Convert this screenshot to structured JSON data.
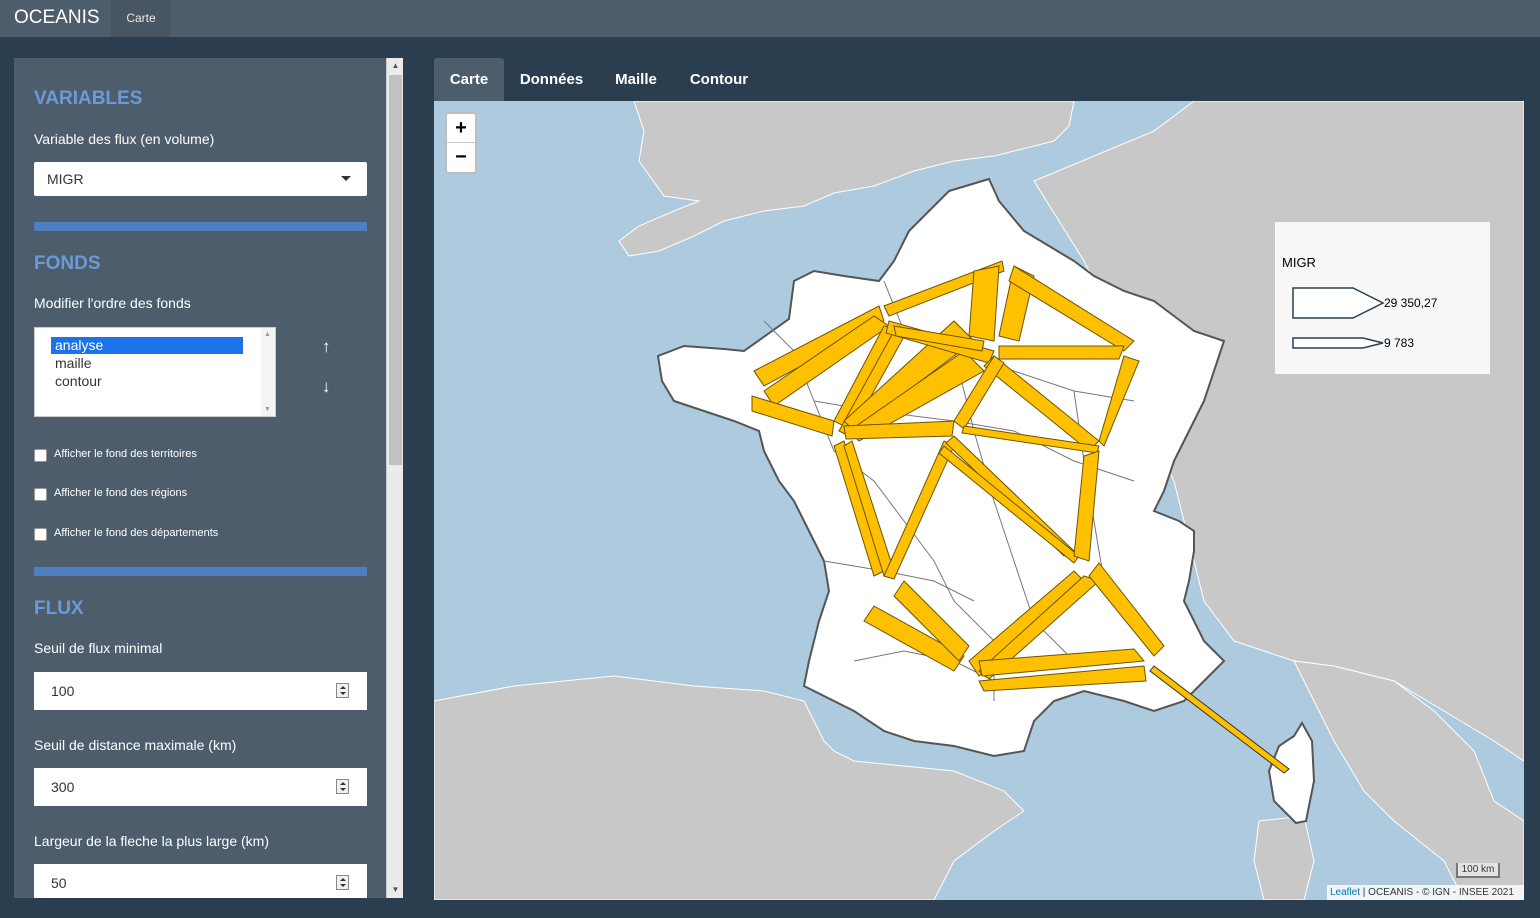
{
  "app": {
    "brand": "OCEANIS",
    "nav_tab": "Carte"
  },
  "sidebar": {
    "variables": {
      "title": "VARIABLES",
      "flux_label": "Variable des flux (en volume)",
      "flux_value": "MIGR"
    },
    "fonds": {
      "title": "FONDS",
      "order_label": "Modifier l'ordre des fonds",
      "layers": [
        "analyse",
        "maille",
        "contour"
      ],
      "selected_layer": "analyse",
      "checkboxes": [
        "Afficher le fond des territoires",
        "Afficher le fond des régions",
        "Afficher le fond des départements"
      ]
    },
    "flux": {
      "title": "FLUX",
      "min_label": "Seuil de flux minimal",
      "min_value": "100",
      "dist_label": "Seuil de distance maximale (km)",
      "dist_value": "300",
      "width_label": "Largeur de la fleche la plus large (km)",
      "width_value": "50"
    }
  },
  "tabs": [
    "Carte",
    "Données",
    "Maille",
    "Contour"
  ],
  "active_tab": "Carte",
  "map": {
    "zoom_in": "+",
    "zoom_out": "−",
    "legend": {
      "title": "MIGR",
      "max_value": "29 350,27",
      "min_value": "9 783"
    },
    "scale": "100 km",
    "attribution_leaflet": "Leaflet",
    "attribution_rest": " | OCEANIS - © IGN - INSEE 2021",
    "colors": {
      "sea": "#aecadf",
      "neighbors": "#c8c8c8",
      "france": "#ffffff",
      "arrows": "#ffc000",
      "arrow_stroke": "#6b5400"
    }
  }
}
